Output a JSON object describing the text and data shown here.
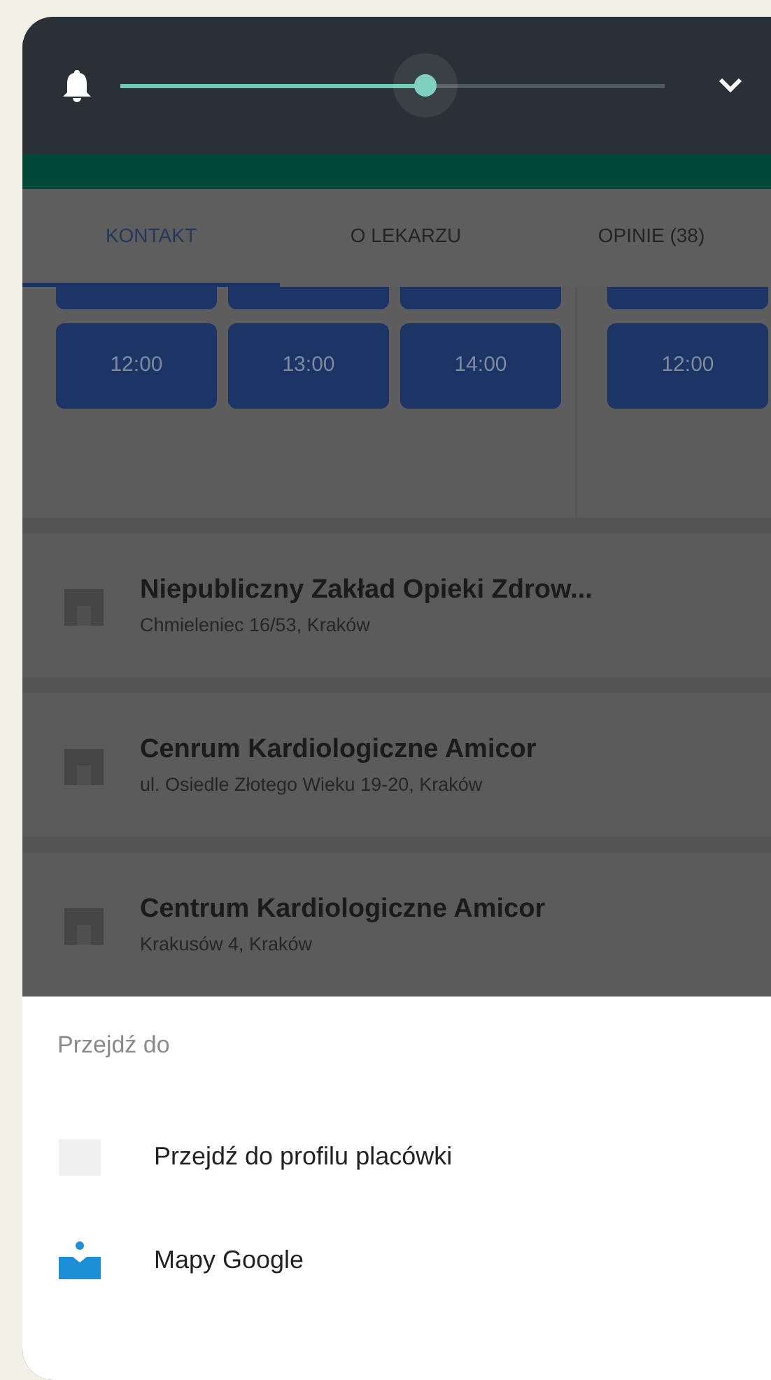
{
  "volume_panel": {
    "level": 0.56
  },
  "tabs": [
    {
      "label": "KONTAKT",
      "selected": true
    },
    {
      "label": "O LEKARZU",
      "selected": false
    },
    {
      "label": "OPINIE (38)",
      "selected": false
    }
  ],
  "slot_columns": [
    {
      "times": [
        "12:00",
        "13:00",
        "14:00"
      ]
    },
    {
      "times": [
        "12:00"
      ]
    }
  ],
  "facilities": [
    {
      "name": "Niepubliczny Zakład Opieki Zdrow...",
      "address": "Chmieleniec 16/53, Kraków"
    },
    {
      "name": "Cenrum Kardiologiczne Amicor",
      "address": "ul. Osiedle Złotego Wieku 19-20, Kraków"
    },
    {
      "name": "Centrum Kardiologiczne Amicor",
      "address": "Krakusów 4, Kraków"
    }
  ],
  "sheet": {
    "title": "Przejdź do",
    "actions": [
      {
        "label": "Przejdź do profilu placówki",
        "kind": "profile"
      },
      {
        "label": "Mapy Google",
        "kind": "maps"
      }
    ]
  }
}
